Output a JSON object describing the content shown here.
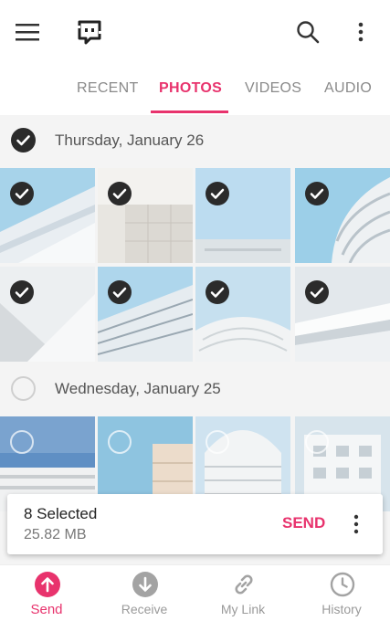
{
  "app": {
    "colors": {
      "accent": "#e8336d",
      "check": "#2b2b2b",
      "muted": "#9a9a9a"
    }
  },
  "toolbar": {
    "menu_icon": "hamburger-menu-icon",
    "logo_icon": "send-anywhere-logo-icon",
    "search_icon": "search-icon",
    "more_icon": "more-vertical-icon"
  },
  "tabs": [
    {
      "label": "RECENT",
      "active": false
    },
    {
      "label": "PHOTOS",
      "active": true
    },
    {
      "label": "VIDEOS",
      "active": false
    },
    {
      "label": "AUDIO",
      "active": false
    }
  ],
  "groups": [
    {
      "date": "Thursday, January 26",
      "selected": true
    },
    {
      "date": "Wednesday, January 25",
      "selected": false
    }
  ],
  "selection": {
    "count_text": "8 Selected",
    "size_text": "25.82 MB",
    "send_label": "SEND"
  },
  "bottom_nav": [
    {
      "label": "Send",
      "icon": "upload-arrow-icon",
      "active": true
    },
    {
      "label": "Receive",
      "icon": "download-arrow-icon",
      "active": false
    },
    {
      "label": "My Link",
      "icon": "link-icon",
      "active": false
    },
    {
      "label": "History",
      "icon": "clock-icon",
      "active": false
    }
  ]
}
